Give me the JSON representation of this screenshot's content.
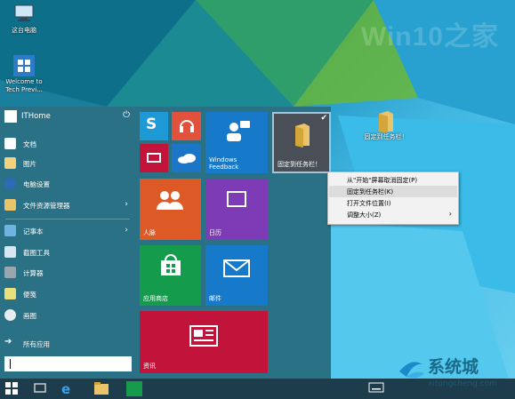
{
  "desktop": {
    "icons": [
      {
        "label": "这台电脑",
        "icon": "computer-icon"
      },
      {
        "label": "Welcome to Tech Previ...",
        "icon": "windows-icon"
      },
      {
        "label": "固定到任务栏！",
        "icon": "folder-icon"
      }
    ],
    "watermark": "Win10之家"
  },
  "start_menu": {
    "user": "ITHome",
    "power_icon": "power-icon",
    "items": [
      {
        "label": "文档",
        "icon": "documents-icon"
      },
      {
        "label": "图片",
        "icon": "pictures-icon"
      },
      {
        "label": "电脑设置",
        "icon": "gear-icon"
      },
      {
        "label": "文件资源管理器",
        "icon": "file-explorer-icon",
        "arrow": "›"
      },
      {
        "label": "记事本",
        "icon": "notepad-icon",
        "arrow": "›"
      },
      {
        "label": "截图工具",
        "icon": "snipping-tool-icon"
      },
      {
        "label": "计算器",
        "icon": "calculator-icon"
      },
      {
        "label": "便笺",
        "icon": "sticky-notes-icon"
      },
      {
        "label": "画图",
        "icon": "paint-icon"
      }
    ],
    "all_apps": "所有应用",
    "tiles": [
      {
        "label": "",
        "icon": "skype-icon",
        "color": "#1d9ad6"
      },
      {
        "label": "",
        "icon": "music-icon",
        "color": "#e2513c"
      },
      {
        "label": "",
        "icon": "video-icon",
        "color": "#c2143a"
      },
      {
        "label": "",
        "icon": "onedrive-icon",
        "color": "#1c76c8"
      },
      {
        "label": "Windows Feedback",
        "icon": "feedback-icon",
        "color": "#1679c9"
      },
      {
        "label": "固定到任务栏！",
        "icon": "folder-icon",
        "color": "#4a4f57"
      },
      {
        "label": "人脉",
        "icon": "people-icon",
        "color": "#dd5a26"
      },
      {
        "label": "日历",
        "icon": "calendar-icon",
        "color": "#7d3bb5"
      },
      {
        "label": "应用商店",
        "icon": "store-icon",
        "color": "#159b4c"
      },
      {
        "label": "邮件",
        "icon": "mail-icon",
        "color": "#1679c9"
      },
      {
        "label": "资讯",
        "icon": "news-icon",
        "color": "#c2143a"
      }
    ]
  },
  "context_menu": {
    "items": [
      {
        "label": "从\"开始\"屏幕取消固定(P)"
      },
      {
        "label": "固定到任务栏(K)"
      },
      {
        "label": "打开文件位置(I)"
      },
      {
        "label": "调整大小(Z)",
        "submenu": "›"
      }
    ]
  },
  "taskbar": {
    "buttons": [
      "start-icon",
      "task-view-icon",
      "ie-icon",
      "file-explorer-icon",
      "store-icon"
    ],
    "tray": "keyboard-icon"
  },
  "brand": {
    "cn": "系统城",
    "en": "xitongcheng.com"
  }
}
